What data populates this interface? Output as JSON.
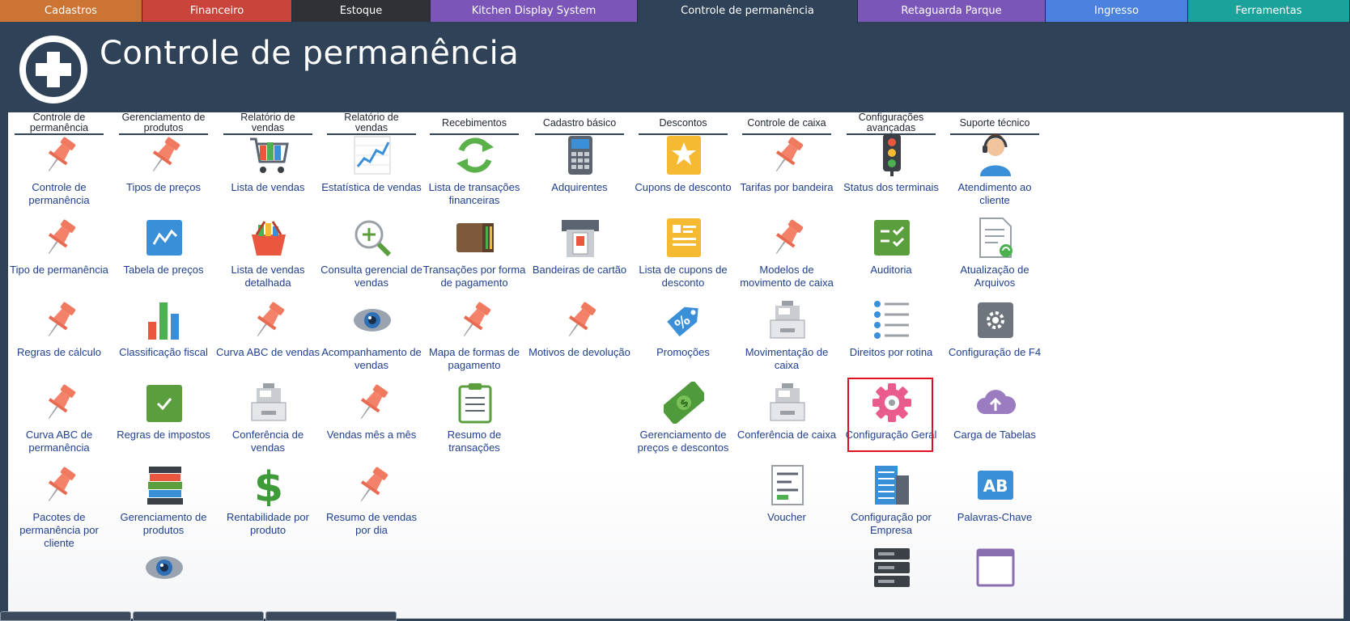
{
  "tabs": [
    {
      "label": "Cadastros",
      "color": "#cc7434",
      "width": 176
    },
    {
      "label": "Financeiro",
      "color": "#c9443b",
      "width": 185
    },
    {
      "label": "Estoque",
      "color": "#2e3135",
      "width": 171
    },
    {
      "label": "Kitchen Display System",
      "color": "#7b55b8",
      "width": 256
    },
    {
      "label": "Controle de permanência",
      "color": "#2f4258",
      "width": 272,
      "active": true
    },
    {
      "label": "Retaguarda Parque",
      "color": "#7a56b8",
      "width": 232
    },
    {
      "label": "Ingresso",
      "color": "#4b82e0",
      "width": 176
    },
    {
      "label": "Ferramentas",
      "color": "#1aa39a",
      "width": 200
    }
  ],
  "header": {
    "title": "Controle de permanência"
  },
  "columns": [
    {
      "head": "Controle de permanência",
      "items": [
        {
          "label": "Controle de permanência",
          "icon": "pin-icon"
        },
        {
          "label": "Tipo de permanência",
          "icon": "pin-icon"
        },
        {
          "label": "Regras de cálculo",
          "icon": "pin-icon"
        },
        {
          "label": "Curva ABC de permanência",
          "icon": "pin-icon"
        },
        {
          "label": "Pacotes de permanência por cliente",
          "icon": "pin-icon"
        }
      ]
    },
    {
      "head": "Gerenciamento de produtos",
      "items": [
        {
          "label": "Tipos de preços",
          "icon": "pin-icon"
        },
        {
          "label": "Tabela de preços",
          "icon": "price-chart-icon"
        },
        {
          "label": "Classificação fiscal",
          "icon": "bar-chart-icon"
        },
        {
          "label": "Regras de impostos",
          "icon": "check-doc-icon"
        },
        {
          "label": "Gerenciamento de produtos",
          "icon": "books-icon"
        },
        {
          "label": "",
          "icon": "eye-icon"
        }
      ]
    },
    {
      "head": "Relatório de vendas",
      "items": [
        {
          "label": "Lista de vendas",
          "icon": "cart-icon"
        },
        {
          "label": "Lista de vendas detalhada",
          "icon": "basket-icon"
        },
        {
          "label": "Curva ABC de vendas",
          "icon": "pin-icon"
        },
        {
          "label": "Conferência de vendas",
          "icon": "register-icon"
        },
        {
          "label": "Rentabilidade por produto",
          "icon": "dollar-icon"
        }
      ]
    },
    {
      "head": "Relatório de vendas",
      "items": [
        {
          "label": "Estatística de vendas",
          "icon": "line-chart-icon"
        },
        {
          "label": "Consulta gerencial de vendas",
          "icon": "zoom-icon"
        },
        {
          "label": "Acompanhamento de vendas",
          "icon": "eye-icon"
        },
        {
          "label": "Vendas mês a mês",
          "icon": "pin-icon"
        },
        {
          "label": "Resumo de vendas por dia",
          "icon": "pin-icon"
        }
      ]
    },
    {
      "head": "Recebimentos",
      "items": [
        {
          "label": "Lista de transações financeiras",
          "icon": "refresh-icon"
        },
        {
          "label": "Transações por forma de pagamento",
          "icon": "wallet-icon"
        },
        {
          "label": "Mapa de formas de pagamento",
          "icon": "pin-icon"
        },
        {
          "label": "Resumo de transações",
          "icon": "clipboard-icon"
        }
      ]
    },
    {
      "head": "Cadastro básico",
      "items": [
        {
          "label": "Adquirentes",
          "icon": "card-terminal-icon"
        },
        {
          "label": "Bandeiras de cartão",
          "icon": "atm-icon"
        },
        {
          "label": "Motivos de devolução",
          "icon": "pin-icon"
        }
      ]
    },
    {
      "head": "Descontos",
      "items": [
        {
          "label": "Cupons de desconto",
          "icon": "coupon-icon"
        },
        {
          "label": "Lista de cupons de desconto",
          "icon": "coupon-list-icon"
        },
        {
          "label": "Promoções",
          "icon": "percent-tag-icon"
        },
        {
          "label": "Gerenciamento de preços e descontos",
          "icon": "banknote-icon"
        }
      ]
    },
    {
      "head": "Controle de caixa",
      "items": [
        {
          "label": "Tarifas por bandeira",
          "icon": "pin-icon"
        },
        {
          "label": "Modelos de movimento de caixa",
          "icon": "pin-icon"
        },
        {
          "label": "Movimentação de caixa",
          "icon": "register-icon"
        },
        {
          "label": "Conferência de caixa",
          "icon": "register-icon"
        },
        {
          "label": "Voucher",
          "icon": "voucher-icon"
        }
      ]
    },
    {
      "head": "Configurações avançadas",
      "items": [
        {
          "label": "Status dos terminais",
          "icon": "traffic-light-icon"
        },
        {
          "label": "Auditoria",
          "icon": "audit-icon"
        },
        {
          "label": "Direitos por rotina",
          "icon": "list-icon"
        },
        {
          "label": "Configuração Geral",
          "icon": "gear-icon",
          "selected": true
        },
        {
          "label": "Configuração por Empresa",
          "icon": "building-icon"
        },
        {
          "label": "",
          "icon": "server-icon"
        }
      ]
    },
    {
      "head": "Suporte técnico",
      "items": [
        {
          "label": "Atendimento ao cliente",
          "icon": "support-agent-icon"
        },
        {
          "label": "Atualização de Arquivos",
          "icon": "file-update-icon"
        },
        {
          "label": "Configuração de F4",
          "icon": "settings-box-icon"
        },
        {
          "label": "Carga de Tabelas",
          "icon": "cloud-upload-icon"
        },
        {
          "label": "Palavras-Chave",
          "icon": "keywords-icon",
          "text": "AB"
        },
        {
          "label": "",
          "icon": "window-icon"
        }
      ]
    }
  ]
}
